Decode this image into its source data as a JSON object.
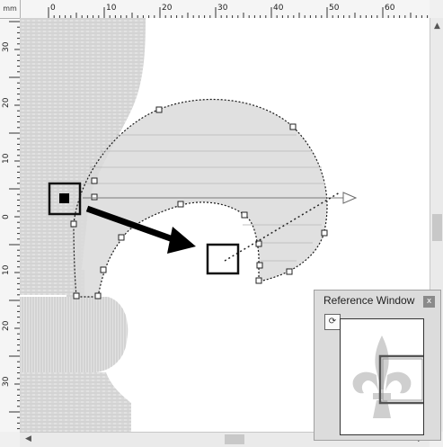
{
  "ruler": {
    "unit": "mm",
    "top_labels": [
      "0",
      "10",
      "20",
      "30",
      "40",
      "50",
      "60"
    ],
    "left_labels": [
      "30",
      "20",
      "10",
      "0",
      "10",
      "20",
      "30"
    ]
  },
  "icons": {
    "scroll_up": "up-arrow-icon",
    "scroll_down": "down-arrow-icon",
    "scroll_left": "left-arrow-icon",
    "scroll_right": "right-arrow-icon",
    "reference_refresh": "refresh-icon",
    "reference_close": "close-icon"
  },
  "reference_window": {
    "title": "Reference Window",
    "close_label": "x"
  },
  "colors": {
    "stitch_fill": "#d9d9d9",
    "outline": "#222222",
    "highlight_arrow": "#000000",
    "direction_arrow": "#7a7a7a"
  }
}
